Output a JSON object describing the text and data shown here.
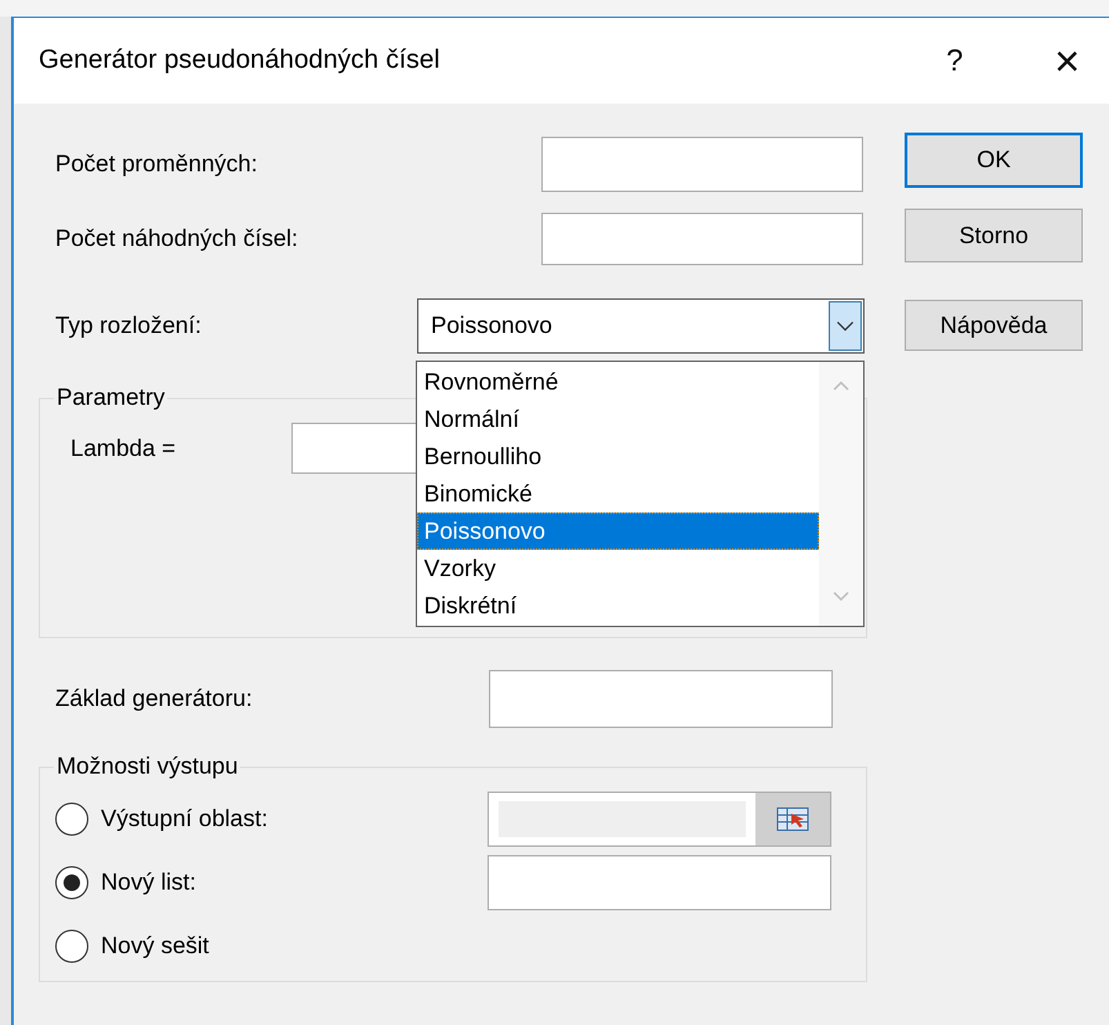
{
  "window": {
    "title": "Generátor pseudonáhodných čísel",
    "help_button": "?",
    "close_button": "×"
  },
  "fields": [
    {
      "label": "Počet proměnných:"
    },
    {
      "label": "Počet náhodných čísel:"
    }
  ],
  "distribution": {
    "label": "Typ rozložení:",
    "value": "Poissonovo",
    "expanded": true,
    "options": [
      {
        "label": "Rovnoměrné",
        "selected": false
      },
      {
        "label": "Normální",
        "selected": false
      },
      {
        "label": "Bernoulliho",
        "selected": false
      },
      {
        "label": "Binomické",
        "selected": false
      },
      {
        "label": "Poissonovo",
        "selected": true
      },
      {
        "label": "Vzorky",
        "selected": false
      },
      {
        "label": "Diskrétní",
        "selected": false
      }
    ]
  },
  "buttons": [
    {
      "label": "OK",
      "default": true
    },
    {
      "label": "Storno",
      "default": false
    },
    {
      "label": "Nápověda",
      "default": false
    }
  ],
  "parameters": {
    "title": "Parametry",
    "fields": [
      {
        "label": "Lambda ="
      }
    ]
  },
  "seed": {
    "label": "Základ generátoru:"
  },
  "output": {
    "title": "Možnosti výstupu",
    "options": [
      {
        "label": "Výstupní oblast:",
        "selected": false,
        "kind": "range",
        "field": {
          "disabled": true
        }
      },
      {
        "label": "Nový list:",
        "selected": true,
        "kind": "text",
        "field": {
          "disabled": false
        }
      },
      {
        "label": "Nový sešit",
        "selected": false,
        "kind": "plain"
      }
    ]
  }
}
